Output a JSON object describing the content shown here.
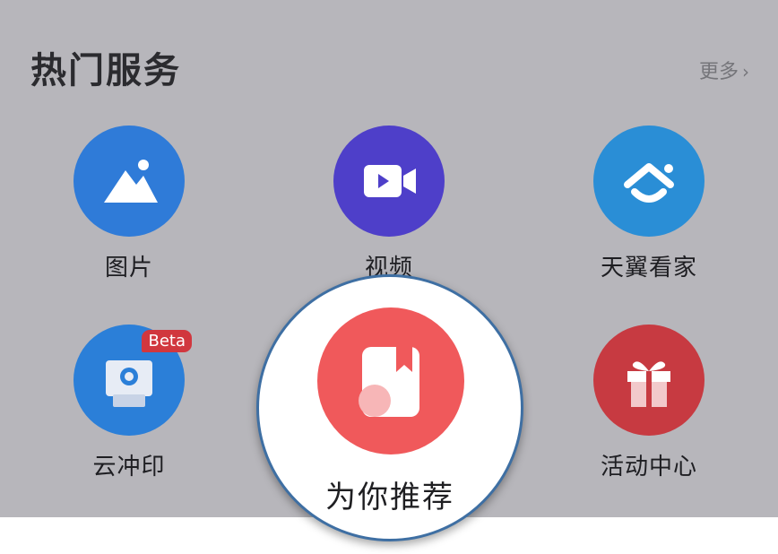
{
  "section": {
    "title": "热门服务",
    "more": "更多",
    "more_icon": "chevron-right-icon"
  },
  "services": [
    {
      "label": "图片",
      "icon": "mountain-picture-icon",
      "color": "#2f7bd8"
    },
    {
      "label": "视频",
      "icon": "video-camera-icon",
      "color": "#4e3fc9"
    },
    {
      "label": "天翼看家",
      "icon": "home-camera-icon",
      "color": "#2a8ed6"
    },
    {
      "label": "云冲印",
      "icon": "photo-print-icon",
      "color": "#2b7fd8",
      "badge": "Beta"
    },
    {
      "label": "为你推荐",
      "icon": "recommend-book-icon",
      "color": "#f0595b"
    },
    {
      "label": "活动中心",
      "icon": "gift-icon",
      "color": "#c73a41"
    }
  ]
}
